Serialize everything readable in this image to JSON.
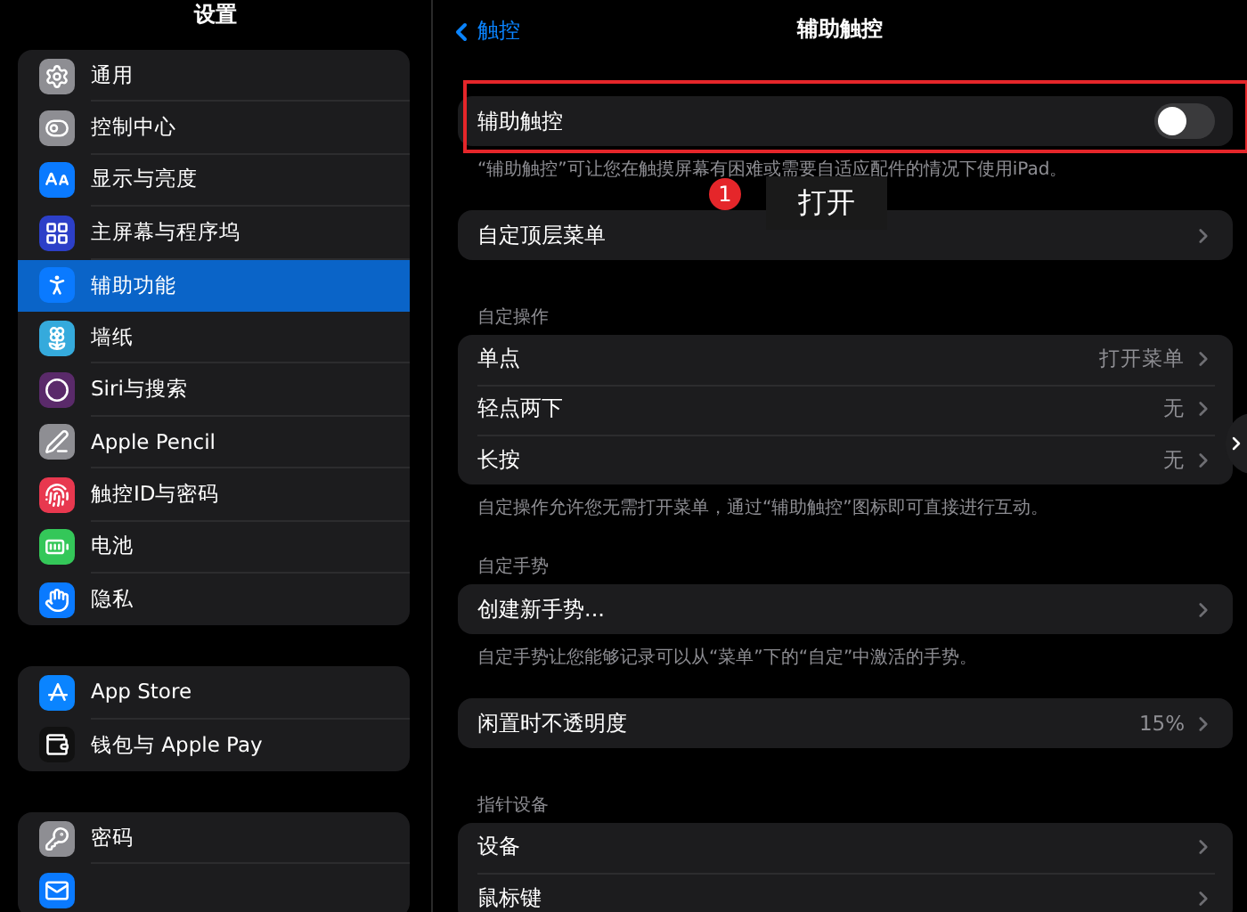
{
  "sidebar": {
    "title": "设置",
    "groups": [
      {
        "items": [
          {
            "label": "通用",
            "selected": false
          },
          {
            "label": "控制中心",
            "selected": false
          },
          {
            "label": "显示与亮度",
            "selected": false
          },
          {
            "label": "主屏幕与程序坞",
            "selected": false
          },
          {
            "label": "辅助功能",
            "selected": true
          },
          {
            "label": "墙纸",
            "selected": false
          },
          {
            "label": "Siri与搜索",
            "selected": false
          },
          {
            "label": "Apple Pencil",
            "selected": false
          },
          {
            "label": "触控ID与密码",
            "selected": false
          },
          {
            "label": "电池",
            "selected": false
          },
          {
            "label": "隐私",
            "selected": false
          }
        ]
      },
      {
        "items": [
          {
            "label": "App Store",
            "selected": false
          },
          {
            "label": "钱包与 Apple Pay",
            "selected": false
          }
        ]
      },
      {
        "items": [
          {
            "label": "密码",
            "selected": false
          },
          {
            "selected": false
          }
        ]
      }
    ]
  },
  "nav": {
    "back": "触控",
    "title": "辅助触控"
  },
  "sections": [
    {
      "rows": [
        {
          "kind": "toggle",
          "label": "辅助触控",
          "on": false
        }
      ],
      "footer": "“辅助触控”可让您在触摸屏幕有困难或需要自适应配件的情况下使用iPad。"
    },
    {
      "rows": [
        {
          "kind": "link",
          "label": "自定顶层菜单"
        }
      ]
    },
    {
      "header": "自定操作",
      "rows": [
        {
          "kind": "link",
          "label": "单点",
          "value": "打开菜单"
        },
        {
          "kind": "link",
          "label": "轻点两下",
          "value": "无"
        },
        {
          "kind": "link",
          "label": "长按",
          "value": "无"
        }
      ],
      "footer": "自定操作允许您无需打开菜单，通过“辅助触控”图标即可直接进行互动。"
    },
    {
      "header": "自定手势",
      "rows": [
        {
          "kind": "link",
          "label": "创建新手势..."
        }
      ],
      "footer": "自定手势让您能够记录可以从“菜单”下的“自定”中激活的手势。"
    },
    {
      "rows": [
        {
          "kind": "link",
          "label": "闲置时不透明度",
          "value": "15%"
        }
      ]
    },
    {
      "header": "指针设备",
      "rows": [
        {
          "kind": "link",
          "label": "设备"
        },
        {
          "kind": "link",
          "label": "鼠标键"
        }
      ]
    }
  ],
  "annotation": {
    "number": "1",
    "label": "打开"
  }
}
